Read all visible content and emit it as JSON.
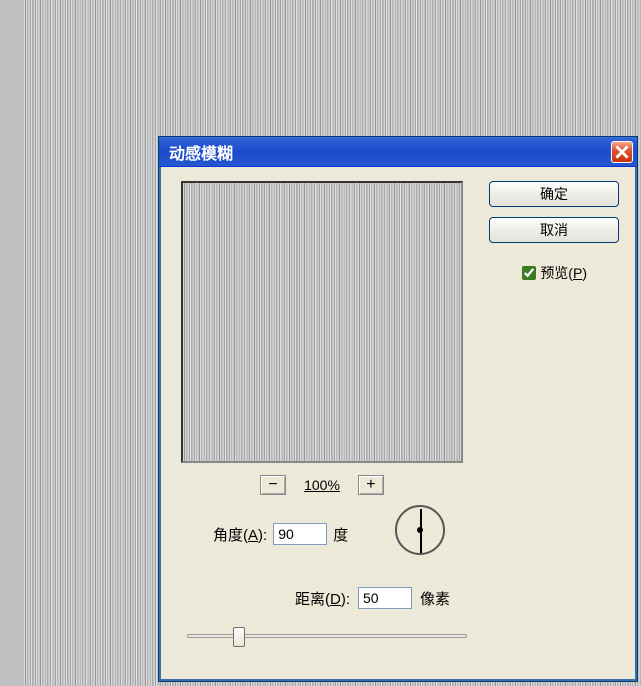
{
  "dialog": {
    "title": "动感模糊",
    "ok": "确定",
    "cancel": "取消",
    "preview_label_pre": "预览(",
    "preview_label_key": "P",
    "preview_label_post": ")",
    "preview_checked": true,
    "zoom_pct": "100%",
    "zoom_out": "−",
    "zoom_in": "+",
    "angle_label_pre": "角度(",
    "angle_label_key": "A",
    "angle_label_post": "):",
    "angle_value": "90",
    "angle_unit": "度",
    "distance_label_pre": "距离(",
    "distance_label_key": "D",
    "distance_label_post": "):",
    "distance_value": "50",
    "distance_unit": "像素",
    "slider_pct": 17
  }
}
